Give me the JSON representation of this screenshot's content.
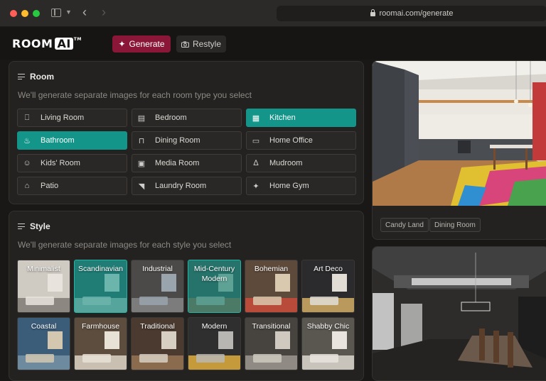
{
  "browser": {
    "url": "roomai.com/generate"
  },
  "header": {
    "logo_main": "ROOM",
    "logo_ai": "AI",
    "logo_tm": "TM",
    "generate_label": "Generate",
    "restyle_label": "Restyle",
    "accent_color": "#8a1738"
  },
  "room": {
    "title": "Room",
    "subtitle": "We'll generate separate images for each room type you select",
    "items": [
      {
        "label": "Living Room",
        "icon": "sofa-icon",
        "selected": false
      },
      {
        "label": "Bedroom",
        "icon": "bed-icon",
        "selected": false
      },
      {
        "label": "Kitchen",
        "icon": "kitchen-icon",
        "selected": true
      },
      {
        "label": "Bathroom",
        "icon": "bathtub-icon",
        "selected": true
      },
      {
        "label": "Dining Room",
        "icon": "dining-table-icon",
        "selected": false
      },
      {
        "label": "Home Office",
        "icon": "laptop-icon",
        "selected": false
      },
      {
        "label": "Kids' Room",
        "icon": "teddy-bear-icon",
        "selected": false
      },
      {
        "label": "Media Room",
        "icon": "tv-icon",
        "selected": false
      },
      {
        "label": "Mudroom",
        "icon": "hanger-icon",
        "selected": false
      },
      {
        "label": "Patio",
        "icon": "patio-icon",
        "selected": false
      },
      {
        "label": "Laundry Room",
        "icon": "iron-icon",
        "selected": false
      },
      {
        "label": "Home Gym",
        "icon": "dumbbell-icon",
        "selected": false
      }
    ],
    "selected_color": "#14958a"
  },
  "style": {
    "title": "Style",
    "subtitle": "We'll generate separate images for each style you select",
    "items": [
      {
        "label": "Minimalist",
        "selected": false
      },
      {
        "label": "Scandinavian",
        "selected": true
      },
      {
        "label": "Industrial",
        "selected": false
      },
      {
        "label": "Mid-Century Modern",
        "selected": true
      },
      {
        "label": "Bohemian",
        "selected": false
      },
      {
        "label": "Art Deco",
        "selected": false
      },
      {
        "label": "Coastal",
        "selected": false
      },
      {
        "label": "Farmhouse",
        "selected": false
      },
      {
        "label": "Traditional",
        "selected": false
      },
      {
        "label": "Modern",
        "selected": false
      },
      {
        "label": "Transitional",
        "selected": false
      },
      {
        "label": "Shabby Chic",
        "selected": false
      }
    ]
  },
  "results": {
    "tags": [
      "Candy Land",
      "Dining Room"
    ]
  }
}
